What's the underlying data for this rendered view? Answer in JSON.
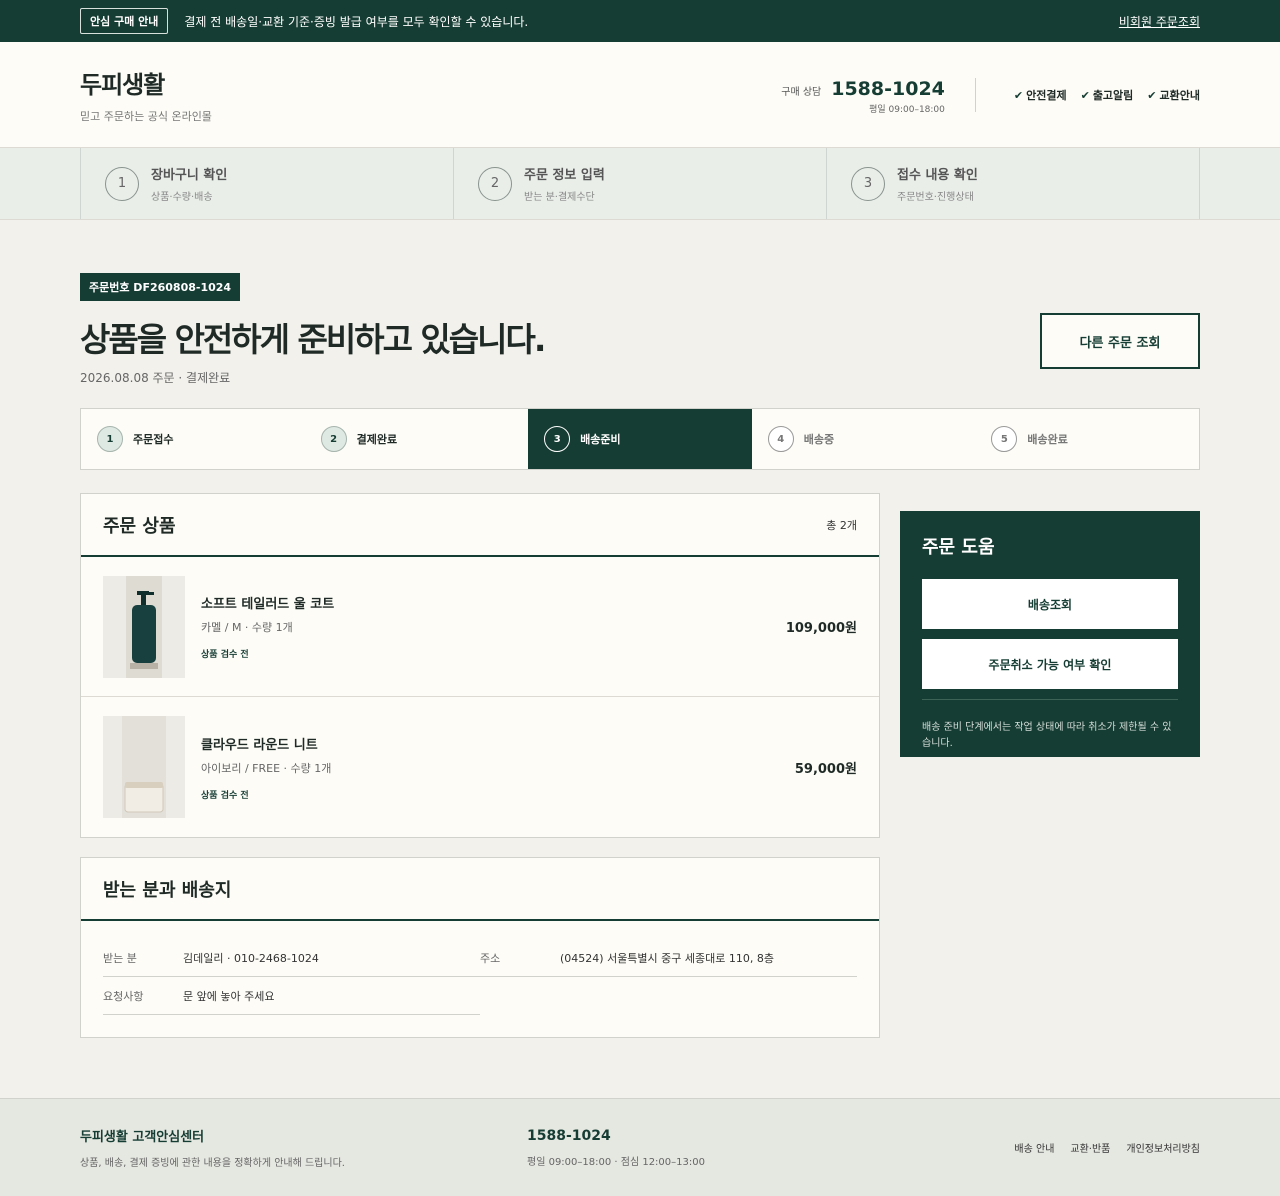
{
  "topbar": {
    "badge": "안심 구매 안내",
    "notice": "결제 전 배송일·교환 기준·증빙 발급 여부를 모두 확인할 수 있습니다.",
    "guest_link": "비회원 주문조회"
  },
  "header": {
    "brand": "두피생활",
    "tagline": "믿고 주문하는 공식 온라인몰",
    "contact_label": "구매 상담",
    "phone": "1588-1024",
    "hours": "평일 09:00–18:00",
    "badges": [
      "안전결제",
      "출고알림",
      "교환안내"
    ]
  },
  "checkout_steps": [
    {
      "num": "1",
      "name": "장바구니 확인",
      "desc": "상품·수량·배송"
    },
    {
      "num": "2",
      "name": "주문 정보 입력",
      "desc": "받는 분·결제수단"
    },
    {
      "num": "3",
      "name": "접수 내용 확인",
      "desc": "주문번호·진행상태"
    }
  ],
  "order": {
    "number_label": "주문번호 DF260808-1024",
    "title": "상품을 안전하게 준비하고 있습니다.",
    "subtitle": "2026.08.08 주문 · 결제완료",
    "other_button": "다른 주문 조회"
  },
  "progress": [
    {
      "num": "1",
      "label": "주문접수",
      "state": "done"
    },
    {
      "num": "2",
      "label": "결제완료",
      "state": "done"
    },
    {
      "num": "3",
      "label": "배송준비",
      "state": "active"
    },
    {
      "num": "4",
      "label": "배송중",
      "state": "todo"
    },
    {
      "num": "5",
      "label": "배송완료",
      "state": "todo"
    }
  ],
  "products": {
    "title": "주문 상품",
    "count": "총 2개",
    "items": [
      {
        "name": "소프트 테일러드 울 코트",
        "option": "카멜 / M · 수량 1개",
        "state": "상품 검수 전",
        "price": "109,000원",
        "thumb": "bottle-icon"
      },
      {
        "name": "클라우드 라운드 니트",
        "option": "아이보리 / FREE · 수량 1개",
        "state": "상품 검수 전",
        "price": "59,000원",
        "thumb": "jar-icon"
      }
    ]
  },
  "shipping": {
    "title": "받는 분과 배송지",
    "recipient_label": "받는 분",
    "recipient": "김데일리 · 010-2468-1024",
    "address_label": "주소",
    "address": "(04524) 서울특별시 중구 세종대로 110, 8층",
    "request_label": "요청사항",
    "request": "문 앞에 놓아 주세요"
  },
  "help": {
    "title": "주문 도움",
    "track_button": "배송조회",
    "cancel_button": "주문취소 가능 여부 확인",
    "note": "배송 준비 단계에서는 작업 상태에 따라 취소가 제한될 수 있습니다."
  },
  "footer": {
    "center_name": "두피생활 고객안심센터",
    "center_desc": "상품, 배송, 결제 증빙에 관한 내용을 정확하게 안내해 드립니다.",
    "phone": "1588-1024",
    "hours": "평일 09:00–18:00 · 점심 12:00–13:00",
    "links": [
      "배송 안내",
      "교환·반품",
      "개인정보처리방침"
    ]
  },
  "colors": {
    "brand": "#163d33",
    "background": "#f3f1ec",
    "surface": "#fdfcf7"
  }
}
